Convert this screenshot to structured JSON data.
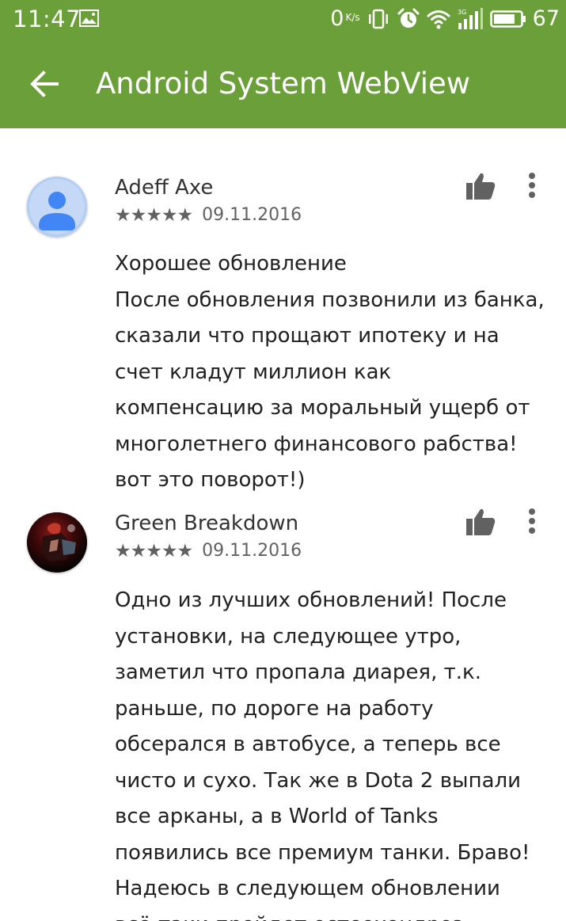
{
  "status_bar": {
    "time": "11:47",
    "net_speed": "0",
    "net_unit": "K/s",
    "battery": "67",
    "icons": [
      "image-icon",
      "vibrate-icon",
      "alarm-icon",
      "wifi-icon",
      "signal-icon",
      "battery-icon"
    ],
    "color": "#6a9f3a"
  },
  "app_bar": {
    "title": "Android System WebView",
    "back_icon": "arrow-back-icon"
  },
  "reviews": [
    {
      "author": "Adeff Axe",
      "stars": "★★★★★",
      "rating": 5,
      "date": "09.11.2016",
      "title": "Хорошее обновление",
      "text": "После обновления позвонили из банка, сказали что прощают ипотеку и на счет кладут миллион как компенсацию за моральный ущерб от многолетнего финансового рабства! вот это поворот!)"
    },
    {
      "author": "Green Breakdown",
      "stars": "★★★★★",
      "rating": 5,
      "date": "09.11.2016",
      "title": "",
      "text": "Одно из лучших обновлений! После установки, на следующее утро, заметил что пропала диарея, т.к. раньше, по дороге на работу обсерался в автобусе, а теперь все чисто и сухо. Так же в Dota 2 выпали все арканы, а в World of Tanks появились все премиум танки. Браво! Надеюсь в следующем обновлении всё-таки пройдет остеохондроз."
    }
  ]
}
